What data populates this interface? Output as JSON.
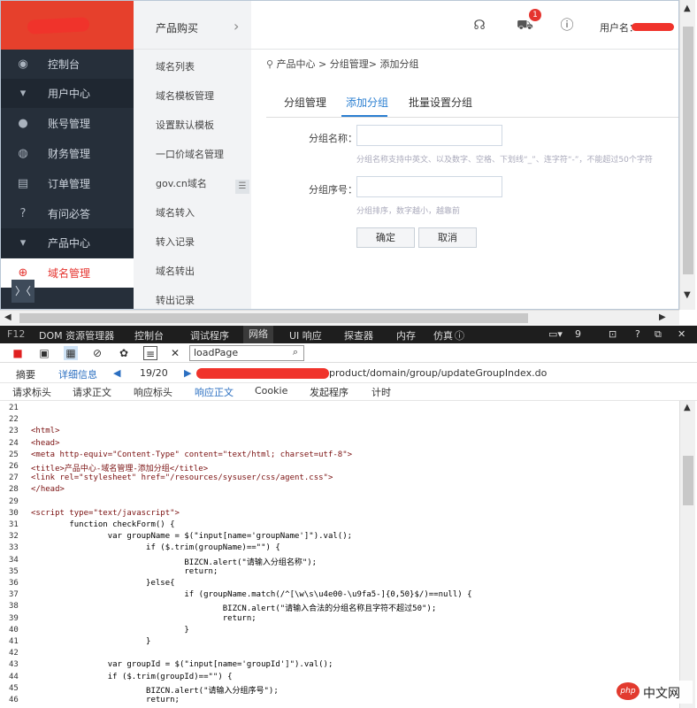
{
  "sidebar": {
    "items": [
      {
        "label": "控制台",
        "icon": "dashboard-icon",
        "top": 0
      },
      {
        "label": "用户中心",
        "icon": "caret-down-icon"
      },
      {
        "label": "账号管理",
        "icon": "user-icon"
      },
      {
        "label": "财务管理",
        "icon": "finance-icon"
      },
      {
        "label": "订单管理",
        "icon": "order-icon"
      },
      {
        "label": "有问必答",
        "icon": "help-icon"
      },
      {
        "label": "产品中心",
        "icon": "caret-down-icon"
      },
      {
        "label": "域名管理",
        "icon": "globe-icon"
      }
    ],
    "collapse_glyph": "〉〈"
  },
  "subnav": {
    "title": "产品购买",
    "items": [
      "域名列表",
      "域名模板管理",
      "设置默认模板",
      "一口价域名管理",
      "gov.cn域名",
      "域名转入",
      "转入记录",
      "域名转出",
      "转出记录"
    ]
  },
  "topbar": {
    "cart_count": "1",
    "username_label": "用户名："
  },
  "breadcrumb": "产品中心 > 分组管理> 添加分组",
  "tabs": [
    "分组管理",
    "添加分组",
    "批量设置分组"
  ],
  "form": {
    "name_label": "分组名称：",
    "name_hint": "分组名称支持中英文、以及数字、空格、下划线“_”、连字符“-”，不能超过50个字符",
    "order_label": "分组序号：",
    "order_hint": "分组排序，数字越小，越靠前",
    "confirm": "确定",
    "cancel": "取消"
  },
  "devtools": {
    "tabs": [
      "F12",
      "DOM 资源管理器",
      "控制台",
      "调试程序",
      "网络",
      "UI 响应",
      "探查器",
      "内存",
      "仿真"
    ],
    "active_tab": "网络",
    "right_count": "9",
    "search_value": "loadPage",
    "summary_label": "摘要",
    "detail_label": "详细信息",
    "page_counter": "19/20",
    "url": "product/domain/group/updateGroupIndex.do",
    "subtabs": [
      "请求标头",
      "请求正文",
      "响应标头",
      "响应正文",
      "Cookie",
      "发起程序",
      "计时"
    ],
    "active_subtab": "响应正文"
  },
  "code_lines": [
    {
      "n": "21",
      "t": ""
    },
    {
      "n": "22",
      "t": ""
    },
    {
      "n": "23",
      "t": "<html>"
    },
    {
      "n": "24",
      "t": "<head>"
    },
    {
      "n": "25",
      "t": "<meta http-equiv=\"Content-Type\" content=\"text/html; charset=utf-8\">"
    },
    {
      "n": "26",
      "t": "<title>产品中心-域名管理-添加分组</title>"
    },
    {
      "n": "27",
      "t": "<link rel=\"stylesheet\" href=\"/resources/sysuser/css/agent.css\">"
    },
    {
      "n": "28",
      "t": "</head>"
    },
    {
      "n": "29",
      "t": ""
    },
    {
      "n": "30",
      "t": "<script type=\"text/javascript\">"
    },
    {
      "n": "31",
      "t": "        function checkForm() {"
    },
    {
      "n": "32",
      "t": "                var groupName = $(\"input[name='groupName']\").val();"
    },
    {
      "n": "33",
      "t": "                        if ($.trim(groupName)==\"\") {"
    },
    {
      "n": "34",
      "t": "                                BIZCN.alert(\"请输入分组名称\");"
    },
    {
      "n": "35",
      "t": "                                return;"
    },
    {
      "n": "36",
      "t": "                        }else{"
    },
    {
      "n": "37",
      "t": "                                if (groupName.match(/^[\\w\\s\\u4e00-\\u9fa5-]{0,50}$/)==null) {"
    },
    {
      "n": "38",
      "t": "                                        BIZCN.alert(\"请输入合法的分组名称且字符不超过50\");"
    },
    {
      "n": "39",
      "t": "                                        return;"
    },
    {
      "n": "40",
      "t": "                                }"
    },
    {
      "n": "41",
      "t": "                        }"
    },
    {
      "n": "42",
      "t": ""
    },
    {
      "n": "43",
      "t": "                var groupId = $(\"input[name='groupId']\").val();"
    },
    {
      "n": "44",
      "t": "                if ($.trim(groupId)==\"\") {"
    },
    {
      "n": "45",
      "t": "                        BIZCN.alert(\"请输入分组序号\");"
    },
    {
      "n": "46",
      "t": "                        return;"
    }
  ],
  "watermark": {
    "logo": "php",
    "text": "中文网"
  },
  "colors": {
    "brand_red": "#e5342f",
    "sidebar_dark": "#262f3a",
    "accent_blue": "#2b7fd1",
    "devtools_bar": "#1e1e1e"
  }
}
